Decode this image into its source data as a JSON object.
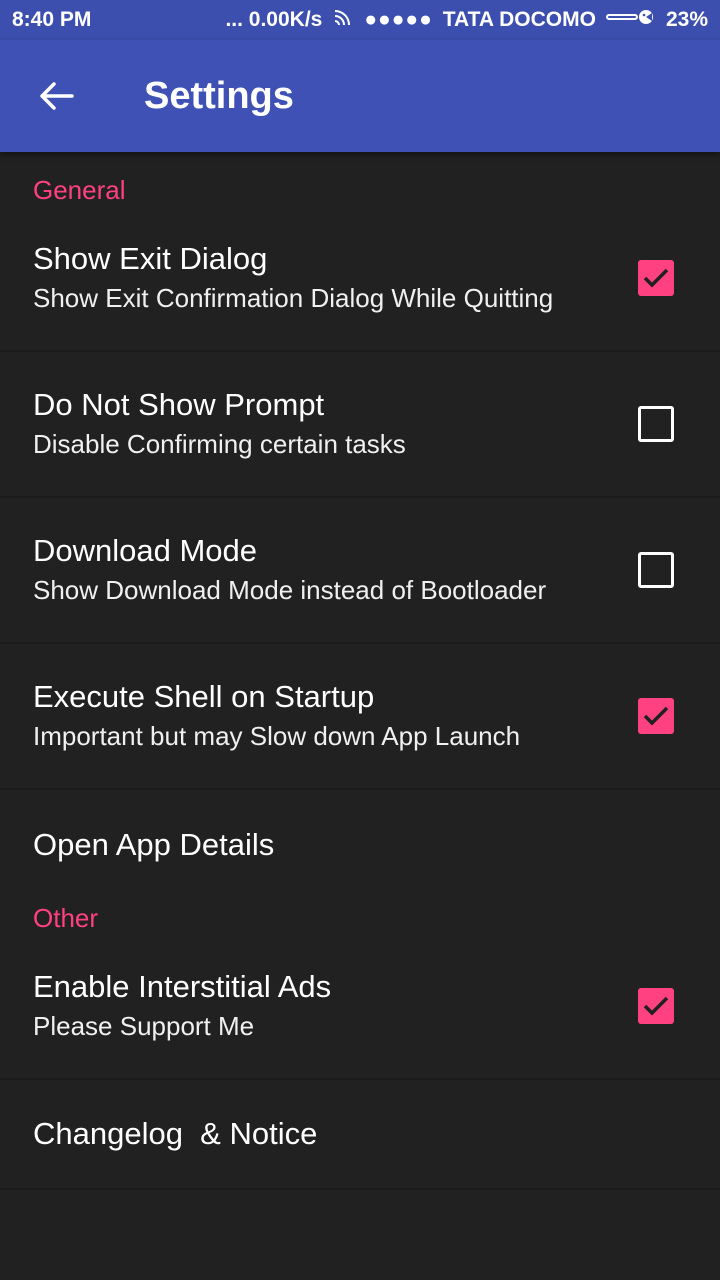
{
  "status_bar": {
    "time": "8:40 PM",
    "net_speed": "... 0.00K/s",
    "signal_dots": "●●●●●",
    "carrier": "TATA DOCOMO",
    "battery": "23%"
  },
  "app_bar": {
    "title": "Settings",
    "back_icon": "arrow-left-icon"
  },
  "sections": {
    "general": "General",
    "other": "Other"
  },
  "settings": {
    "show_exit_dialog": {
      "title": "Show Exit Dialog",
      "summary": "Show Exit Confirmation Dialog While Quitting",
      "checked": true
    },
    "do_not_show_prompt": {
      "title": "Do Not Show Prompt",
      "summary": "Disable Confirming certain tasks",
      "checked": false
    },
    "download_mode": {
      "title": "Download Mode",
      "summary": "Show Download Mode instead of Bootloader",
      "checked": false
    },
    "execute_shell": {
      "title": "Execute Shell on Startup",
      "summary": "Important but may Slow down App Launch",
      "checked": true
    },
    "open_app_details": {
      "title": "Open App Details"
    },
    "interstitial_ads": {
      "title": "Enable Interstitial Ads",
      "summary": "Please Support Me",
      "checked": true
    },
    "changelog": {
      "title": "Changelog  & Notice"
    }
  },
  "colors": {
    "accent": "#ff4081",
    "primary": "#3f51b5",
    "primary_dark": "#3d4fae",
    "background": "#212121"
  }
}
